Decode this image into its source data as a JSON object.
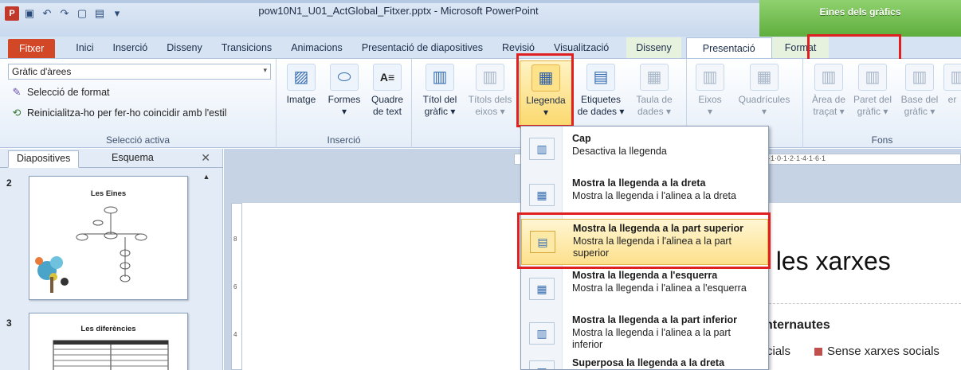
{
  "window": {
    "title": "pow10N1_U01_ActGlobal_Fitxer.pptx - Microsoft PowerPoint",
    "contextual_tools_label": "Eines dels gràfics"
  },
  "quick_access": [
    {
      "icon": "powerpoint-icon",
      "glyph": "P"
    },
    {
      "icon": "save-icon",
      "glyph": "▣"
    },
    {
      "icon": "undo-icon",
      "glyph": "↶"
    },
    {
      "icon": "redo-icon",
      "glyph": "↷"
    },
    {
      "icon": "new-file-icon",
      "glyph": "▢"
    },
    {
      "icon": "open-folder-icon",
      "glyph": "▤"
    },
    {
      "icon": "customize-icon",
      "glyph": "▾"
    }
  ],
  "tabs": [
    "Fitxer",
    "Inici",
    "Inserció",
    "Disseny",
    "Transicions",
    "Animacions",
    "Presentació de diapositives",
    "Revisió",
    "Visualització",
    "Disseny",
    "Presentació",
    "Format"
  ],
  "ribbon": {
    "selection_group": {
      "dropdown_value": "Gràfic d'àrees",
      "format_selection": "Selecció de format",
      "reset_style": "Reinicialitza-ho per fer-ho coincidir amb l'estil",
      "label": "Selecció activa"
    },
    "insert_group": {
      "label": "Inserció",
      "buttons": [
        {
          "line1": "Imatge",
          "line2": ""
        },
        {
          "line1": "Formes",
          "line2": "▾"
        },
        {
          "line1": "Quadre",
          "line2": "de text"
        }
      ]
    },
    "labels_group": {
      "buttons": [
        {
          "line1": "Títol del",
          "line2": "gràfic ▾"
        },
        {
          "line1": "Títols dels",
          "line2": "eixos ▾"
        },
        {
          "line1": "Llegenda",
          "line2": "▾"
        },
        {
          "line1": "Etiquetes",
          "line2": "de dades ▾"
        },
        {
          "line1": "Taula de",
          "line2": "dades ▾"
        }
      ]
    },
    "axes_group": {
      "buttons": [
        {
          "line1": "Eixos",
          "line2": "▾"
        },
        {
          "line1": "Quadrícules",
          "line2": "▾"
        }
      ]
    },
    "background_group": {
      "label": "Fons",
      "buttons": [
        {
          "line1": "Àrea de",
          "line2": "traçat ▾"
        },
        {
          "line1": "Paret del",
          "line2": "gràfic ▾"
        },
        {
          "line1": "Base del",
          "line2": "gràfic ▾"
        },
        {
          "line1": "",
          "line2": "er"
        }
      ]
    }
  },
  "left_panel": {
    "tabs": [
      "Diapositives",
      "Esquema"
    ],
    "close_glyph": "✕",
    "slides": [
      {
        "number": "2",
        "title": "Les Eines"
      },
      {
        "number": "3",
        "title": "Les diferències"
      }
    ]
  },
  "ruler": {
    "horizontal_text": "·1·0·1·2·1·4·1·6·1",
    "vertical_marks": [
      "8",
      "6",
      "4"
    ]
  },
  "legend_menu": {
    "items": [
      {
        "title": "Cap",
        "desc": "Desactiva la llegenda",
        "icon": "no-legend-icon"
      },
      {
        "title": "Mostra la llegenda a la dreta",
        "desc": "Mostra la llegenda i l'alinea a la dreta",
        "icon": "legend-right-icon"
      },
      {
        "title": "Mostra la llegenda a la part superior",
        "desc": "Mostra la llegenda i l'alinea a la part superior",
        "icon": "legend-top-icon"
      },
      {
        "title": "Mostra la llegenda a l'esquerra",
        "desc": "Mostra la llegenda i l'alinea a l'esquerra",
        "icon": "legend-left-icon"
      },
      {
        "title": "Mostra la llegenda a la part inferior",
        "desc": "Mostra la llegenda i l'alinea a la part inferior",
        "icon": "legend-bottom-icon"
      },
      {
        "title": "Superposa la llegenda a la dreta",
        "desc": "",
        "icon": "legend-overlay-right-icon"
      }
    ]
  },
  "slide": {
    "title_fragment": "e les xarxes",
    "subtitle_fragment": "nternautes",
    "legend_left_fragment": "cials",
    "legend_right": "Sense xarxes socials"
  },
  "colors": {
    "file_tab": "#d24726",
    "contextual_green": "#5fae3d",
    "highlight": "#fbd86b",
    "annotation_red": "#e02020",
    "legend_swatch": "#c0504d"
  }
}
